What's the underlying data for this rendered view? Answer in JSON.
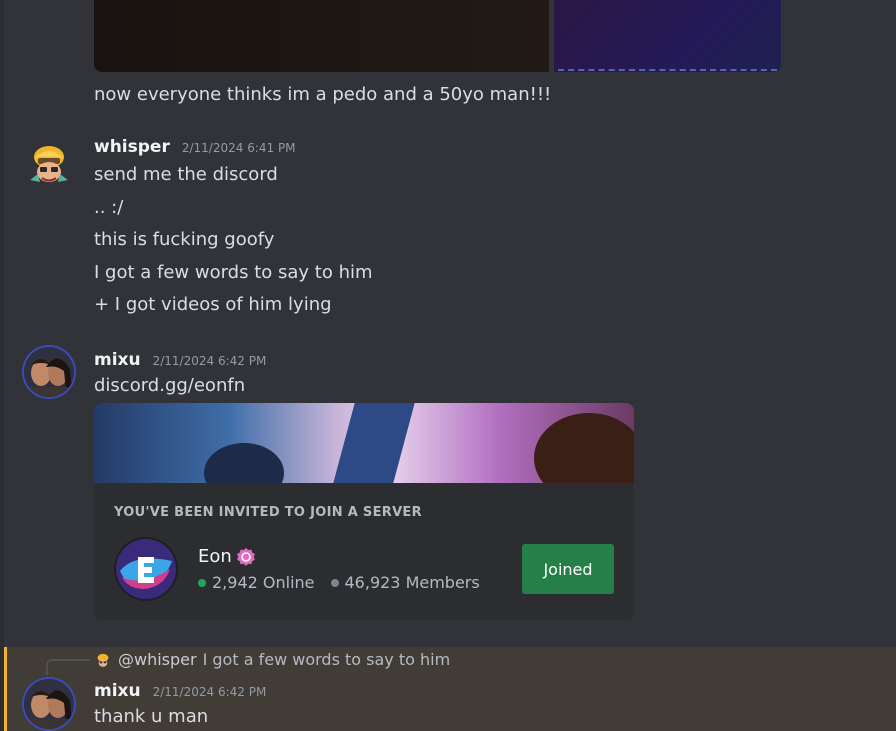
{
  "message_top": {
    "text": "now everyone thinks im a pedo and a 50yo man!!!"
  },
  "message_whisper": {
    "username": "whisper",
    "timestamp": "2/11/2024 6:41 PM",
    "lines": [
      "send me the discord",
      ".. :/",
      "this is fucking goofy",
      "I got a few words to say to him",
      "+ I got videos of him lying"
    ]
  },
  "message_mixu_invite": {
    "username": "mixu",
    "timestamp": "2/11/2024 6:42 PM",
    "text": "discord.gg/eonfn"
  },
  "invite": {
    "label": "YOU'VE BEEN INVITED TO JOIN A SERVER",
    "server_name": "Eon",
    "online": "2,942 Online",
    "members": "46,923 Members",
    "button_label": "Joined",
    "button_color": "#248046"
  },
  "reply": {
    "user": "@whisper",
    "text": "I got a few words to say to him"
  },
  "message_mixu_reply": {
    "username": "mixu",
    "timestamp": "2/11/2024 6:42 PM",
    "text": "thank u man"
  },
  "colors": {
    "background": "#313338",
    "highlight": "#413c36",
    "highlight_bar": "#f0b232",
    "online_dot": "#23a559"
  },
  "icons": [
    "whisper-avatar-icon",
    "mixu-avatar-icon",
    "eon-server-icon",
    "partner-verified-icon"
  ]
}
